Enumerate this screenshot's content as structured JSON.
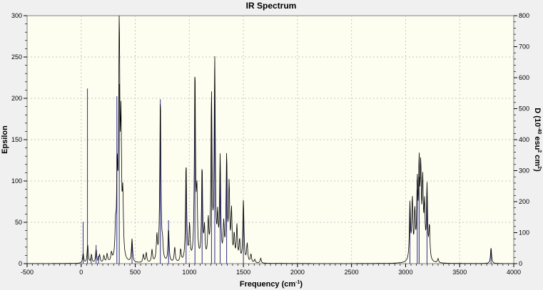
{
  "chart_data": {
    "type": "line",
    "title": "IR Spectrum",
    "xlabel": "Frequency (cm",
    "xlabel_sup": "-1",
    "xlabel_close": ")",
    "ylabel_left": "Epsilon",
    "ylabel_right_parts": {
      "a": "D (10",
      "b": "-40",
      "c": " esu",
      "d": "2",
      "e": " cm",
      "f": "2",
      "g": ")"
    },
    "xlim": [
      -500,
      4000
    ],
    "ylim_left": [
      0,
      300
    ],
    "ylim_right": [
      0,
      800
    ],
    "x_ticks": [
      "-500",
      "0",
      "500",
      "1000",
      "1500",
      "2000",
      "2500",
      "3000",
      "3500",
      "4000"
    ],
    "y_ticks_left": [
      "0",
      "50",
      "100",
      "150",
      "200",
      "250",
      "300"
    ],
    "y_ticks_right": [
      "0",
      "100",
      "200",
      "300",
      "400",
      "500",
      "600",
      "700",
      "800"
    ],
    "grid": true,
    "colors": {
      "plot_background": "#fdfdf0",
      "spectrum_line": "#000000",
      "stick_line": "#2b2b8c"
    },
    "series": [
      {
        "role": "epsilon spectrum (left axis)",
        "peaks": [
          {
            "x": 18,
            "y": 12
          },
          {
            "x": 60,
            "y": 22
          },
          {
            "x": 95,
            "y": 10
          },
          {
            "x": 138,
            "y": 16
          },
          {
            "x": 170,
            "y": 10
          },
          {
            "x": 210,
            "y": 8
          },
          {
            "x": 240,
            "y": 10
          },
          {
            "x": 280,
            "y": 10
          },
          {
            "x": 318,
            "y": 35
          },
          {
            "x": 333,
            "y": 100
          },
          {
            "x": 352,
            "y": 282
          },
          {
            "x": 368,
            "y": 150
          },
          {
            "x": 385,
            "y": 70
          },
          {
            "x": 470,
            "y": 28
          },
          {
            "x": 575,
            "y": 10
          },
          {
            "x": 602,
            "y": 12
          },
          {
            "x": 655,
            "y": 15
          },
          {
            "x": 700,
            "y": 30
          },
          {
            "x": 732,
            "y": 200
          },
          {
            "x": 752,
            "y": 18
          },
          {
            "x": 808,
            "y": 40
          },
          {
            "x": 865,
            "y": 18
          },
          {
            "x": 920,
            "y": 15
          },
          {
            "x": 970,
            "y": 118
          },
          {
            "x": 1002,
            "y": 42
          },
          {
            "x": 1052,
            "y": 228
          },
          {
            "x": 1070,
            "y": 75
          },
          {
            "x": 1118,
            "y": 112
          },
          {
            "x": 1140,
            "y": 36
          },
          {
            "x": 1175,
            "y": 45
          },
          {
            "x": 1205,
            "y": 196
          },
          {
            "x": 1235,
            "y": 238
          },
          {
            "x": 1262,
            "y": 45
          },
          {
            "x": 1285,
            "y": 122
          },
          {
            "x": 1318,
            "y": 40
          },
          {
            "x": 1345,
            "y": 124
          },
          {
            "x": 1368,
            "y": 88
          },
          {
            "x": 1390,
            "y": 58
          },
          {
            "x": 1415,
            "y": 30
          },
          {
            "x": 1440,
            "y": 42
          },
          {
            "x": 1465,
            "y": 25
          },
          {
            "x": 1500,
            "y": 75
          },
          {
            "x": 1535,
            "y": 22
          },
          {
            "x": 1570,
            "y": 10
          },
          {
            "x": 1605,
            "y": 4
          },
          {
            "x": 1660,
            "y": 6
          },
          {
            "x": 3040,
            "y": 68
          },
          {
            "x": 3062,
            "y": 72
          },
          {
            "x": 3085,
            "y": 55
          },
          {
            "x": 3108,
            "y": 88
          },
          {
            "x": 3125,
            "y": 105
          },
          {
            "x": 3140,
            "y": 100
          },
          {
            "x": 3158,
            "y": 88
          },
          {
            "x": 3175,
            "y": 60
          },
          {
            "x": 3198,
            "y": 88
          },
          {
            "x": 3220,
            "y": 40
          },
          {
            "x": 3300,
            "y": 5
          },
          {
            "x": 3790,
            "y": 19
          }
        ]
      },
      {
        "role": "dipole strength sticks (right axis)",
        "sticks": [
          {
            "x": 18,
            "y": 135
          },
          {
            "x": 58,
            "y": 565
          },
          {
            "x": 92,
            "y": 20
          },
          {
            "x": 138,
            "y": 60
          },
          {
            "x": 160,
            "y": 25
          },
          {
            "x": 330,
            "y": 540
          },
          {
            "x": 352,
            "y": 580
          },
          {
            "x": 470,
            "y": 70
          },
          {
            "x": 732,
            "y": 530
          },
          {
            "x": 808,
            "y": 140
          },
          {
            "x": 970,
            "y": 310
          },
          {
            "x": 1052,
            "y": 600
          },
          {
            "x": 1118,
            "y": 300
          },
          {
            "x": 1205,
            "y": 520
          },
          {
            "x": 1235,
            "y": 630
          },
          {
            "x": 1285,
            "y": 330
          },
          {
            "x": 1345,
            "y": 330
          },
          {
            "x": 1500,
            "y": 200
          },
          {
            "x": 3040,
            "y": 170
          },
          {
            "x": 3108,
            "y": 240
          },
          {
            "x": 3125,
            "y": 280
          },
          {
            "x": 3198,
            "y": 230
          },
          {
            "x": 3790,
            "y": 50
          }
        ]
      }
    ]
  }
}
